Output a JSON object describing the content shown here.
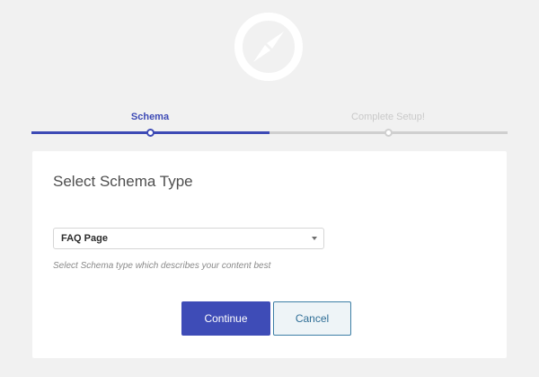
{
  "logo": {
    "icon": "compass-icon",
    "color": "#ffffff"
  },
  "steps": [
    {
      "label": "Schema",
      "state": "active"
    },
    {
      "label": "Complete Setup!",
      "state": "inactive"
    }
  ],
  "progress": {
    "fraction": 0.5,
    "active_color": "#3d4ab5",
    "inactive_color": "#cfcfcf"
  },
  "card": {
    "title": "Select Schema Type",
    "select": {
      "value": "FAQ Page",
      "icon": "chevron-down-icon"
    },
    "help_text": "Select Schema type which describes your content best",
    "buttons": {
      "continue_label": "Continue",
      "cancel_label": "Cancel"
    }
  },
  "colors": {
    "background": "#f1f1f1",
    "primary": "#3e4cb7",
    "secondary_border": "#3e7fa6"
  }
}
